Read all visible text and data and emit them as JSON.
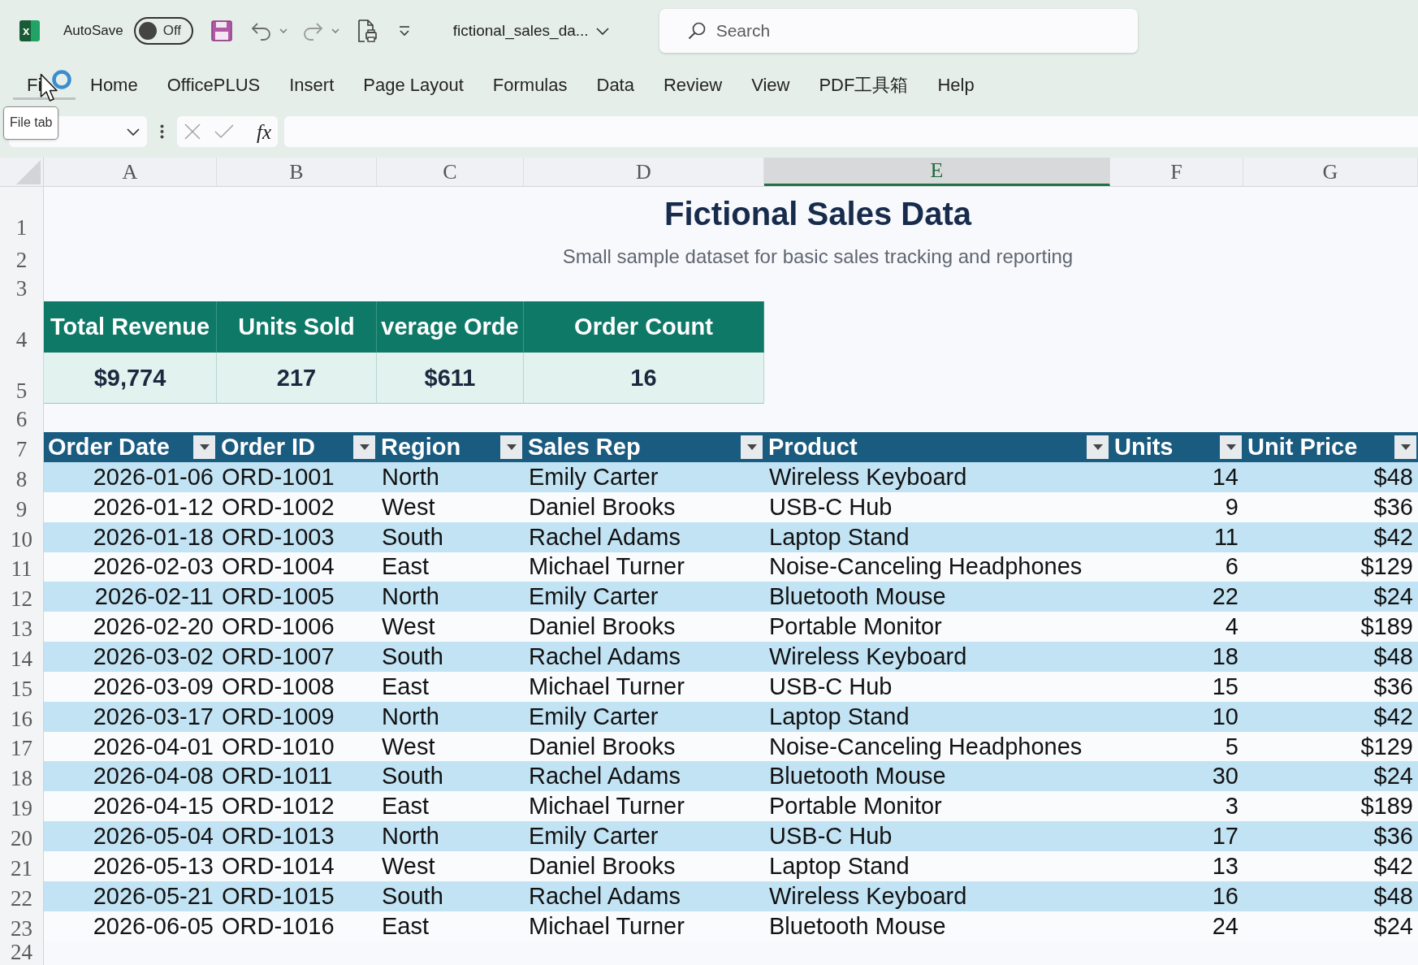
{
  "window": {
    "app_logo": {
      "letter": "x"
    },
    "autosave": {
      "label": "AutoSave",
      "state_label": "Off",
      "on": false
    },
    "file_name": "fictional_sales_da...",
    "search": {
      "placeholder": "Search"
    }
  },
  "ribbon_tabs": [
    {
      "label": "Fi",
      "selected": false,
      "hovered": true
    },
    {
      "label": "Home",
      "selected": false,
      "hovered": false
    },
    {
      "label": "OfficePLUS",
      "selected": false,
      "hovered": false
    },
    {
      "label": "Insert",
      "selected": false,
      "hovered": false
    },
    {
      "label": "Page Layout",
      "selected": false,
      "hovered": false
    },
    {
      "label": "Formulas",
      "selected": false,
      "hovered": false
    },
    {
      "label": "Data",
      "selected": false,
      "hovered": false
    },
    {
      "label": "Review",
      "selected": false,
      "hovered": false
    },
    {
      "label": "View",
      "selected": false,
      "hovered": false
    },
    {
      "label": "PDF工具箱",
      "selected": false,
      "hovered": false
    },
    {
      "label": "Help",
      "selected": false,
      "hovered": false
    }
  ],
  "tooltip": {
    "text": "File tab"
  },
  "formula_bar": {
    "function_button": "fx"
  },
  "sheet": {
    "column_headers": [
      {
        "label": "A",
        "selected": false
      },
      {
        "label": "B",
        "selected": false
      },
      {
        "label": "C",
        "selected": false
      },
      {
        "label": "D",
        "selected": false
      },
      {
        "label": "E",
        "selected": true
      },
      {
        "label": "F",
        "selected": false
      },
      {
        "label": "G",
        "selected": false
      }
    ],
    "rows": [
      {
        "number": "1",
        "kind": "title",
        "text": "Fictional Sales Data"
      },
      {
        "number": "2",
        "kind": "subtitle",
        "text": "Small sample dataset for basic sales tracking and reporting"
      },
      {
        "number": "3",
        "kind": "blank"
      },
      {
        "number": "4",
        "kind": "kpi_labels",
        "cells": [
          "Total Revenue",
          "Units Sold",
          "verage Orde",
          "Order Count"
        ]
      },
      {
        "number": "5",
        "kind": "kpi_values",
        "cells": [
          "$9,774",
          "217",
          "$611",
          "16"
        ]
      },
      {
        "number": "6",
        "kind": "blank"
      },
      {
        "number": "7",
        "kind": "table_header",
        "cells": [
          {
            "label": "Order Date",
            "kind": "date"
          },
          {
            "label": "Order ID",
            "kind": "text"
          },
          {
            "label": "Region",
            "kind": "text"
          },
          {
            "label": "Sales Rep",
            "kind": "text"
          },
          {
            "label": "Product",
            "kind": "text"
          },
          {
            "label": "Units",
            "kind": "number"
          },
          {
            "label": "Unit Price",
            "kind": "number"
          }
        ]
      },
      {
        "number": "8",
        "kind": "data",
        "cells": [
          "2026-01-06",
          "ORD-1001",
          "North",
          "Emily Carter",
          "Wireless Keyboard",
          "14",
          "$48"
        ]
      },
      {
        "number": "9",
        "kind": "data",
        "cells": [
          "2026-01-12",
          "ORD-1002",
          "West",
          "Daniel Brooks",
          "USB-C Hub",
          "9",
          "$36"
        ]
      },
      {
        "number": "10",
        "kind": "data",
        "cells": [
          "2026-01-18",
          "ORD-1003",
          "South",
          "Rachel Adams",
          "Laptop Stand",
          "11",
          "$42"
        ]
      },
      {
        "number": "11",
        "kind": "data",
        "cells": [
          "2026-02-03",
          "ORD-1004",
          "East",
          "Michael Turner",
          "Noise-Canceling Headphones",
          "6",
          "$129"
        ]
      },
      {
        "number": "12",
        "kind": "data",
        "cells": [
          "2026-02-11",
          "ORD-1005",
          "North",
          "Emily Carter",
          "Bluetooth Mouse",
          "22",
          "$24"
        ]
      },
      {
        "number": "13",
        "kind": "data",
        "cells": [
          "2026-02-20",
          "ORD-1006",
          "West",
          "Daniel Brooks",
          "Portable Monitor",
          "4",
          "$189"
        ]
      },
      {
        "number": "14",
        "kind": "data",
        "cells": [
          "2026-03-02",
          "ORD-1007",
          "South",
          "Rachel Adams",
          "Wireless Keyboard",
          "18",
          "$48"
        ]
      },
      {
        "number": "15",
        "kind": "data",
        "cells": [
          "2026-03-09",
          "ORD-1008",
          "East",
          "Michael Turner",
          "USB-C Hub",
          "15",
          "$36"
        ]
      },
      {
        "number": "16",
        "kind": "data",
        "cells": [
          "2026-03-17",
          "ORD-1009",
          "North",
          "Emily Carter",
          "Laptop Stand",
          "10",
          "$42"
        ]
      },
      {
        "number": "17",
        "kind": "data",
        "cells": [
          "2026-04-01",
          "ORD-1010",
          "West",
          "Daniel Brooks",
          "Noise-Canceling Headphones",
          "5",
          "$129"
        ]
      },
      {
        "number": "18",
        "kind": "data",
        "cells": [
          "2026-04-08",
          "ORD-1011",
          "South",
          "Rachel Adams",
          "Bluetooth Mouse",
          "30",
          "$24"
        ]
      },
      {
        "number": "19",
        "kind": "data",
        "cells": [
          "2026-04-15",
          "ORD-1012",
          "East",
          "Michael Turner",
          "Portable Monitor",
          "3",
          "$189"
        ]
      },
      {
        "number": "20",
        "kind": "data",
        "cells": [
          "2026-05-04",
          "ORD-1013",
          "North",
          "Emily Carter",
          "USB-C Hub",
          "17",
          "$36"
        ]
      },
      {
        "number": "21",
        "kind": "data",
        "cells": [
          "2026-05-13",
          "ORD-1014",
          "West",
          "Daniel Brooks",
          "Laptop Stand",
          "13",
          "$42"
        ]
      },
      {
        "number": "22",
        "kind": "data",
        "cells": [
          "2026-05-21",
          "ORD-1015",
          "South",
          "Rachel Adams",
          "Wireless Keyboard",
          "16",
          "$48"
        ]
      },
      {
        "number": "23",
        "kind": "data",
        "cells": [
          "2026-06-05",
          "ORD-1016",
          "East",
          "Michael Turner",
          "Bluetooth Mouse",
          "24",
          "$24"
        ]
      },
      {
        "number": "24",
        "kind": "blank"
      }
    ]
  }
}
